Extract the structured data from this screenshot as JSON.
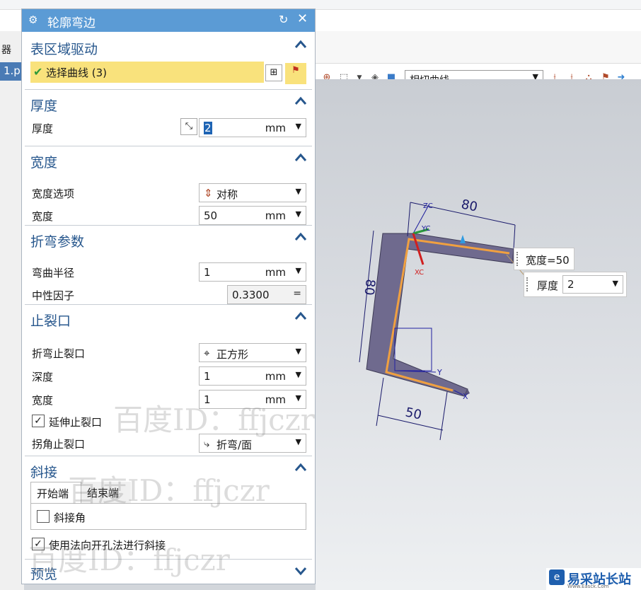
{
  "app": {
    "left_label": "器",
    "file_tab": "1.p",
    "curve_rule": "相切曲线"
  },
  "dialog": {
    "title": "轮廓弯边",
    "sections": {
      "table_drive": {
        "header": "表区域驱动",
        "select_curve": "选择曲线 (3)"
      },
      "thickness": {
        "header": "厚度",
        "label": "厚度",
        "value": "2",
        "unit": "mm"
      },
      "width": {
        "header": "宽度",
        "option_label": "宽度选项",
        "option_value": "对称",
        "width_label": "宽度",
        "width_value": "50",
        "width_unit": "mm"
      },
      "bend_params": {
        "header": "折弯参数",
        "radius_label": "弯曲半径",
        "radius_value": "1",
        "radius_unit": "mm",
        "neutral_label": "中性因子",
        "neutral_value": "0.3300",
        "neutral_op": "="
      },
      "relief": {
        "header": "止裂口",
        "bend_relief_label": "折弯止裂口",
        "bend_relief_value": "正方形",
        "depth_label": "深度",
        "depth_value": "1",
        "depth_unit": "mm",
        "width_label": "宽度",
        "width_value": "1",
        "width_unit": "mm",
        "extend_label": "延伸止裂口",
        "extend_checked": true,
        "corner_label": "拐角止裂口",
        "corner_value": "折弯/面"
      },
      "miter": {
        "header": "斜接",
        "tab_start": "开始端",
        "tab_end": "结束端",
        "miter_angle_label": "斜接角",
        "miter_angle_checked": false,
        "normal_hole_label": "使用法向开孔法进行斜接",
        "normal_hole_checked": true
      },
      "preview": {
        "header": "预览"
      }
    }
  },
  "viewport": {
    "dim_top": "80",
    "dim_side": "80",
    "dim_bottom": "50",
    "width_tag": "宽度=50",
    "thickness_tag_label": "厚度",
    "thickness_tag_value": "2",
    "axis_zc": "ZC",
    "axis_yc": "YC",
    "axis_xc": "XC",
    "axis_y": "Y",
    "axis_x": "X"
  },
  "watermark": "百度ID：ffjczr",
  "brand": {
    "name": "易采站长站",
    "sub": "Www.Easck.Com"
  },
  "icons": [
    "gear-icon",
    "reset-icon",
    "close-icon",
    "chevron-up-icon",
    "chevron-down-icon",
    "check-icon",
    "curve-picker-icon",
    "flag-icon",
    "dimension-swap-icon",
    "symmetric-icon",
    "square-relief-icon",
    "corner-relief-icon"
  ],
  "colors": {
    "title_bar": "#5b9bd5",
    "section_header": "#27578d",
    "selected_row": "#f9e27c",
    "curve_highlight": "#f0a040",
    "part_body": "#6f6a8e"
  }
}
